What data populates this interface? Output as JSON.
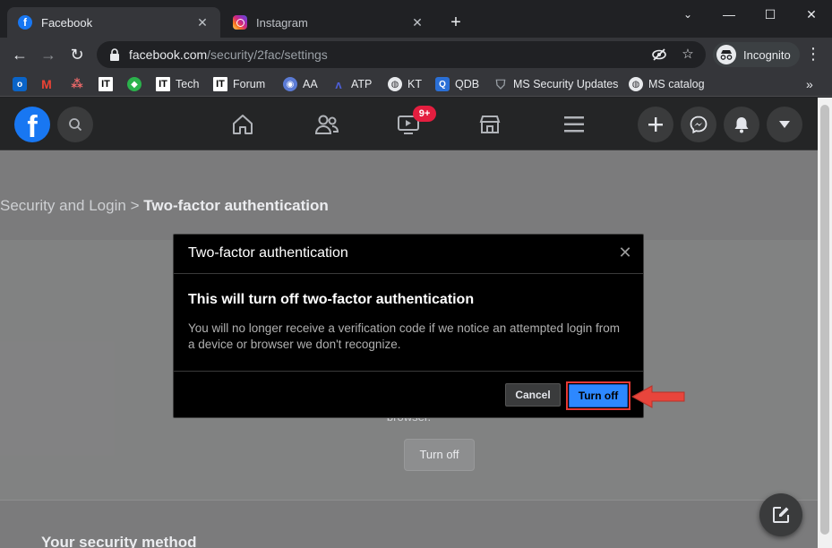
{
  "browser": {
    "tabs": [
      {
        "title": "Facebook",
        "active": true
      },
      {
        "title": "Instagram",
        "active": false
      }
    ],
    "url_host": "facebook.com",
    "url_path": "/security/2fac/settings",
    "profile_label": "Incognito",
    "bookmarks": [
      {
        "label": "",
        "icon": "outlook-icon"
      },
      {
        "label": "",
        "icon": "gmail-icon"
      },
      {
        "label": "",
        "icon": "asana-icon"
      },
      {
        "label": "",
        "icon": "it-icon"
      },
      {
        "label": "",
        "icon": "feedly-icon"
      },
      {
        "label": "Tech",
        "icon": "it-icon"
      },
      {
        "label": "Forum",
        "icon": "it-icon"
      },
      {
        "label": "AA",
        "icon": "eye-icon"
      },
      {
        "label": "ATP",
        "icon": "atp-icon"
      },
      {
        "label": "KT",
        "icon": "globe-icon"
      },
      {
        "label": "QDB",
        "icon": "q-icon"
      },
      {
        "label": "MS Security Updates",
        "icon": "shield-icon"
      },
      {
        "label": "MS catalog",
        "icon": "globe-icon"
      }
    ],
    "colors": {
      "chrome_dark": "#202124",
      "chrome_toolbar": "#35363a"
    }
  },
  "facebook": {
    "watch_badge": "9+",
    "breadcrumb_parent": "Security and Login",
    "breadcrumb_sep": ">",
    "breadcrumb_current": "Two-factor authentication",
    "browser_text": "browser.",
    "page_turnoff_label": "Turn off",
    "section_title": "Your security method",
    "colors": {
      "brand": "#1877f2",
      "badge": "#e41e3f"
    }
  },
  "dialog": {
    "title": "Two-factor authentication",
    "heading": "This will turn off two-factor authentication",
    "body": "You will no longer receive a verification code if we notice an attempted login from a device or browser we don't recognize.",
    "cancel_label": "Cancel",
    "confirm_label": "Turn off",
    "colors": {
      "confirm": "#2d88ff",
      "highlight": "#e53935"
    }
  }
}
